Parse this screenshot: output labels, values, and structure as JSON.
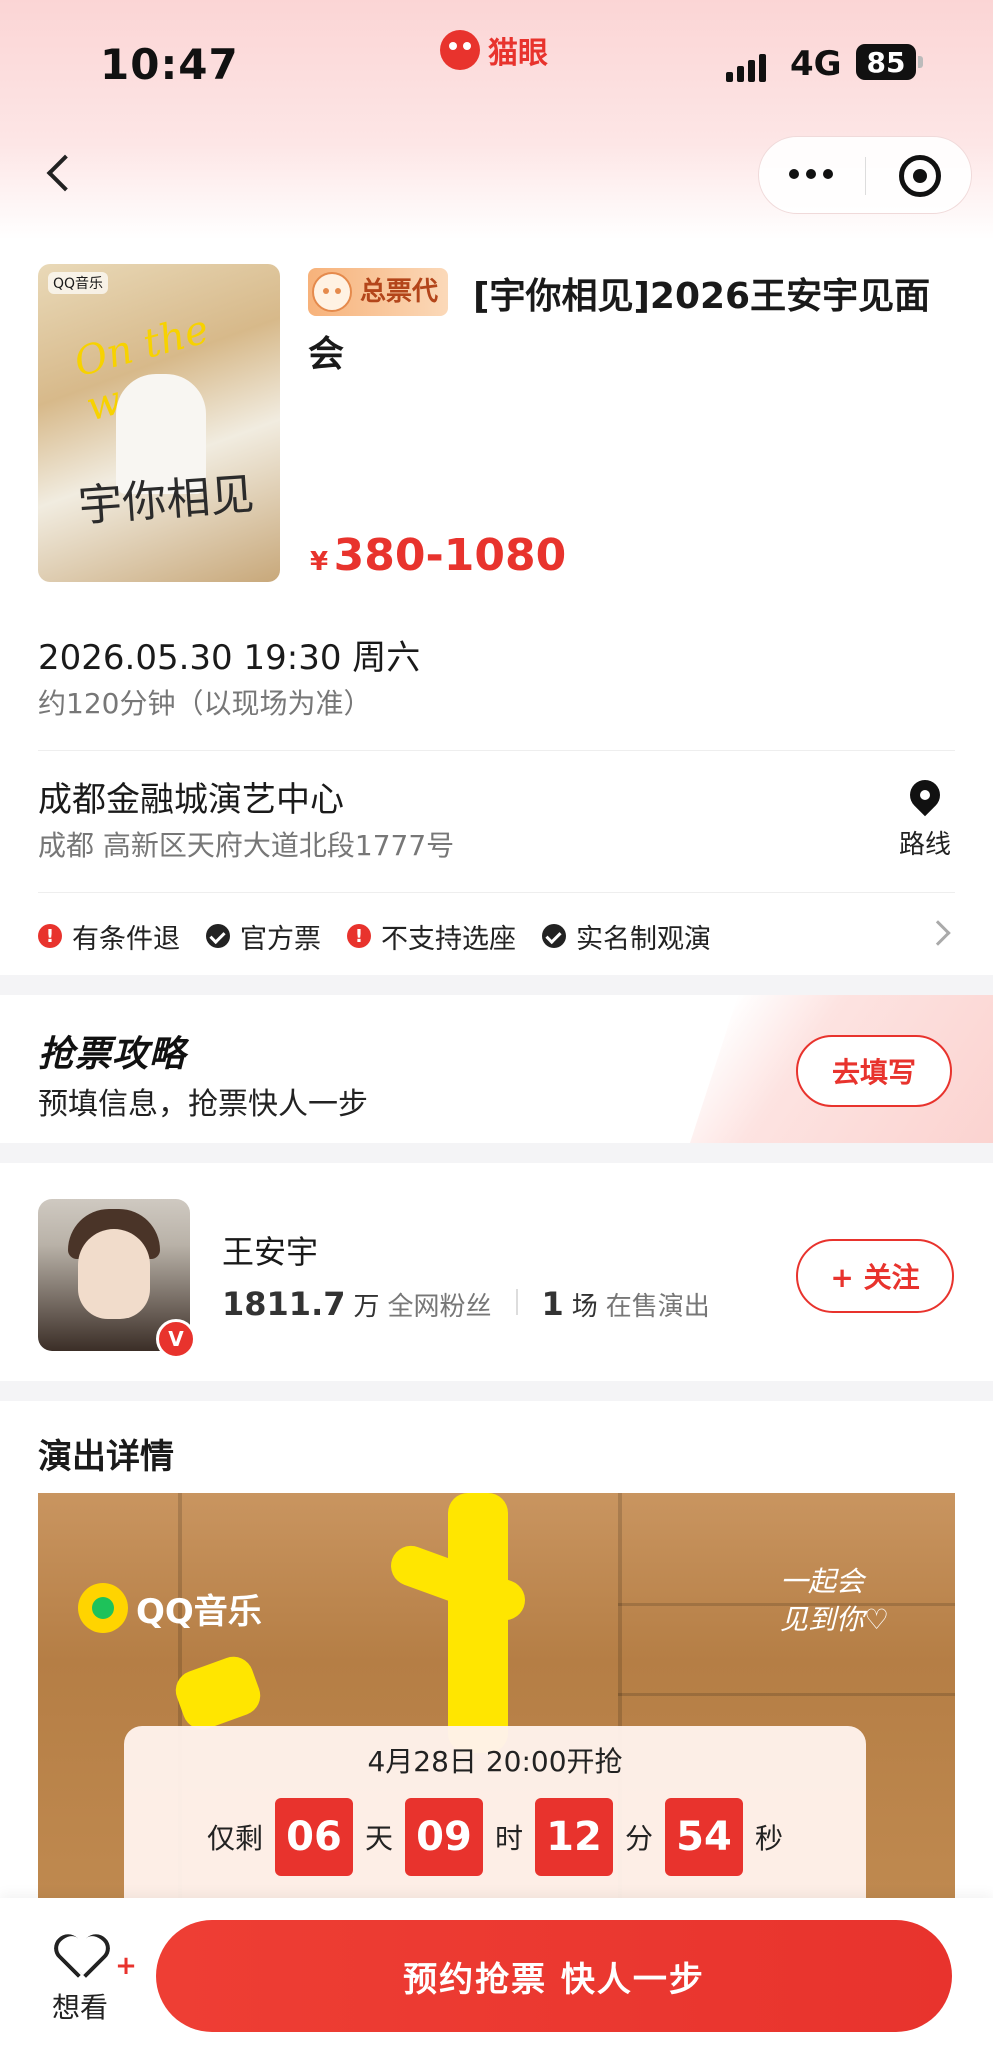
{
  "status_bar": {
    "time": "10:47",
    "app_brand": "猫眼",
    "network": "4G",
    "battery": "85"
  },
  "nav": {
    "back_icon": "chevron-left-icon",
    "more_icon": "more-dots-icon",
    "close_icon": "target-close-icon"
  },
  "event": {
    "tag": "总票代",
    "title": "[宇你相见]2026王安宇见面会",
    "price_symbol": "¥",
    "price_range": "380-1080",
    "poster": {
      "brand": "QQ音乐",
      "script_text": "On the way",
      "title_text": "宇你相见"
    },
    "datetime": "2026.05.30 19:30 周六",
    "duration": "约120分钟（以现场为准）",
    "venue_name": "成都金融城演艺中心",
    "venue_address": "成都 高新区天府大道北段1777号",
    "route_label": "路线",
    "policies": [
      {
        "label": "有条件退",
        "icon": "warning-icon"
      },
      {
        "label": "官方票",
        "icon": "check-icon"
      },
      {
        "label": "不支持选座",
        "icon": "warning-icon"
      },
      {
        "label": "实名制观演",
        "icon": "check-icon"
      }
    ]
  },
  "strategy": {
    "title": "抢票攻略",
    "subtitle": "预填信息，抢票快人一步",
    "button": "去填写"
  },
  "artist": {
    "name": "王安宇",
    "fans_num": "1811.7",
    "fans_unit": "万",
    "fans_label": "全网粉丝",
    "shows_num": "1",
    "shows_unit": "场",
    "shows_label": "在售演出",
    "follow_button": "+ 关注",
    "verified_badge": "V"
  },
  "details": {
    "title": "演出详情",
    "image_brand": "QQ音乐",
    "handwriting": "一起会\n见到你♡",
    "countdown": {
      "start_text": "4月28日  20:00开抢",
      "prefix": "仅剩",
      "days": "06",
      "days_unit": "天",
      "hours": "09",
      "hours_unit": "时",
      "minutes": "12",
      "minutes_unit": "分",
      "seconds": "54",
      "seconds_unit": "秒"
    }
  },
  "bottom": {
    "want_label": "想看",
    "cta_label": "预约抢票 快人一步"
  },
  "colors": {
    "accent": "#e8332d",
    "header_pink": "#fbd5d5"
  }
}
